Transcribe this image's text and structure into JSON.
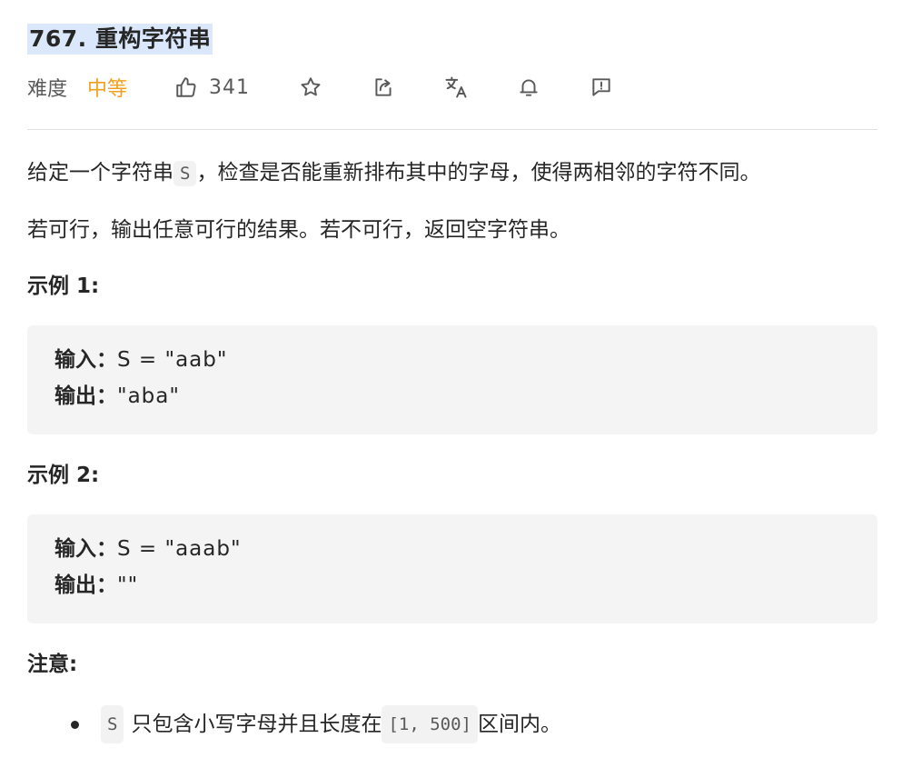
{
  "problem": {
    "title": "767. 重构字符串",
    "difficulty_label": "难度",
    "difficulty": "中等",
    "likes": "341"
  },
  "description": {
    "p1_before": "给定一个字符串",
    "p1_code": "S",
    "p1_after": "，检查是否能重新排布其中的字母，使得两相邻的字符不同。",
    "p2": "若可行，输出任意可行的结果。若不可行，返回空字符串。"
  },
  "examples": [
    {
      "heading": "示例 1:",
      "input_label": "输入：",
      "input_value": "S = \"aab\"",
      "output_label": "输出：",
      "output_value": "\"aba\""
    },
    {
      "heading": "示例 2:",
      "input_label": "输入：",
      "input_value": "S = \"aaab\"",
      "output_label": "输出：",
      "output_value": "\"\""
    }
  ],
  "note": {
    "heading": "注意:",
    "item_code1": "S",
    "item_text1": "只包含小写字母并且长度在",
    "item_code2": "[1, 500]",
    "item_text2": "区间内。"
  },
  "icons": {
    "like": "thumbs-up-icon",
    "star": "star-icon",
    "share": "share-icon",
    "translate": "translate-icon",
    "bell": "bell-icon",
    "feedback": "feedback-icon"
  },
  "colors": {
    "difficulty_medium": "#f0a020",
    "title_highlight": "#dbe8fb",
    "code_bg": "#f4f4f4"
  }
}
